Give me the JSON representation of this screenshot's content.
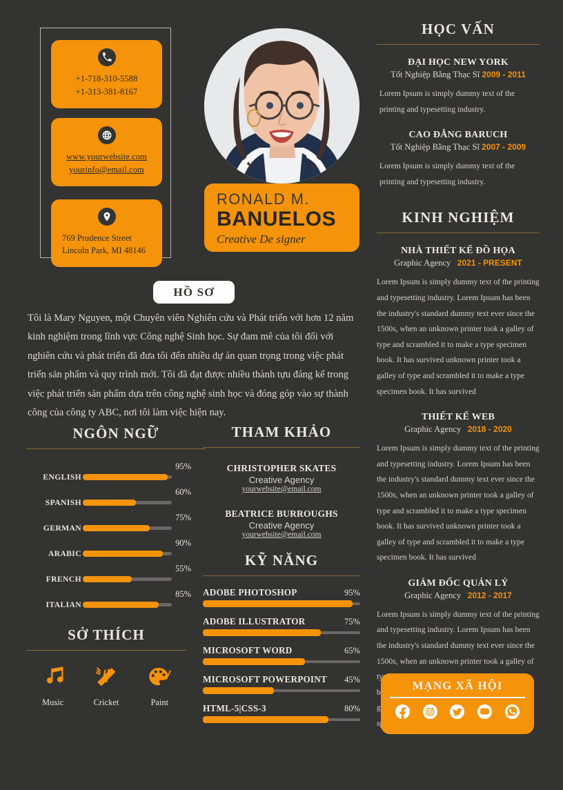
{
  "contact": {
    "phone": {
      "icon": "phone-icon",
      "lines": [
        "+1-718-310-5588",
        "+1-313-381-8167"
      ]
    },
    "web": {
      "icon": "globe-icon",
      "lines": [
        "www.yourwebsite.com",
        "yourinfo@email.com"
      ]
    },
    "address": {
      "icon": "location-pin-icon",
      "lines": [
        "769 Prudence Street",
        "Lincoln Park, MI 48146"
      ]
    }
  },
  "identity": {
    "first_name": "RONALD M.",
    "last_name": "BANUELOS",
    "role": "Creative De signer"
  },
  "profile": {
    "badge": "HỒ SƠ",
    "text": "Tôi là Mary Nguyen, một Chuyên viên Nghiên cứu và Phát triển với hơn 12 năm kinh nghiệm trong lĩnh vực Công nghệ Sinh học. Sự đam mê của tôi đối với nghiên cứu và phát triển đã đưa tôi đến nhiều dự án quan trọng trong việc phát triển sản phẩm và quy trình mới. Tôi đã đạt được nhiều thành tựu đáng kể trong việc phát triển sản phẩm dựa trên công nghệ sinh học và đóng góp vào sự thành công của công ty ABC, nơi tôi làm việc hiện nay."
  },
  "languages": {
    "title": "NGÔN NGỮ",
    "items": [
      {
        "name": "ENGLISH",
        "percent": "95%",
        "value": 95
      },
      {
        "name": "SPANISH",
        "percent": "60%",
        "value": 60
      },
      {
        "name": "GERMAN",
        "percent": "75%",
        "value": 75
      },
      {
        "name": "ARABIC",
        "percent": "90%",
        "value": 90
      },
      {
        "name": "FRENCH",
        "percent": "55%",
        "value": 55
      },
      {
        "name": "ITALIAN",
        "percent": "85%",
        "value": 85
      }
    ]
  },
  "hobbies": {
    "title": "SỞ THÍCH",
    "items": [
      {
        "label": "Music",
        "icon": "music-notes-icon"
      },
      {
        "label": "Cricket",
        "icon": "cricket-bat-icon"
      },
      {
        "label": "Paint",
        "icon": "paint-palette-icon"
      }
    ]
  },
  "references": {
    "title": "THAM KHẢO",
    "items": [
      {
        "name": "CHRISTOPHER SKATES",
        "org": "Creative Agency",
        "email": "yourwebsite@email.com"
      },
      {
        "name": "BEATRICE BURROUGHS",
        "org": "Creative Agency",
        "email": "yourwebsite@email.com"
      }
    ]
  },
  "skills": {
    "title": "KỸ NĂNG",
    "items": [
      {
        "name": "ADOBE PHOTOSHOP",
        "percent": "95%",
        "value": 95
      },
      {
        "name": "ADOBE ILLUSTRATOR",
        "percent": "75%",
        "value": 75
      },
      {
        "name": "MICROSOFT WORD",
        "percent": "65%",
        "value": 65
      },
      {
        "name": "MICROSOFT POWERPOINT",
        "percent": "45%",
        "value": 45
      },
      {
        "name": "HTML-5|CSS-3",
        "percent": "80%",
        "value": 80
      }
    ]
  },
  "education": {
    "title": "HỌC VẤN",
    "items": [
      {
        "school": "ĐẠI HỌC NEW YORK",
        "degree": "Tốt Nghiệp Bằng Thạc Sĩ",
        "years": "2009 - 2011",
        "body": "Lorem Ipsum is simply dummy text of the printing and typesetting industry."
      },
      {
        "school": "CAO ĐẲNG BARUCH",
        "degree": "Tốt Nghiệp Bằng Thạc Sĩ",
        "years": "2007 - 2009",
        "body": "Lorem Ipsum is simply dummy text of the printing and typesetting industry."
      }
    ]
  },
  "experience": {
    "title": "KINH NGHIỆM",
    "items": [
      {
        "role": "NHÀ THIẾT KẾ ĐỒ HỌA",
        "company": "Graphic Agency",
        "years": "2021 - PRESENT",
        "body": "Lorem Ipsum is simply dummy text of the printing and typesetting industry. Lorem Ipsum has been the industry's  standard dummy text ever since the 1500s, when an  unknown printer took a galley of type and scrambled it to  make a type specimen book. It has survived unknown printer took a galley of type and scrambled it to make a type specimen book. It has survived"
      },
      {
        "role": "THIẾT KẾ WEB",
        "company": "Graphic Agency",
        "years": "2018 - 2020",
        "body": "Lorem Ipsum is simply dummy text of the printing and typesetting industry. Lorem Ipsum has been the industry's  standard dummy text ever since the 1500s, when an  unknown printer took a galley of type and scrambled it to  make a type specimen book. It has survived unknown printer took a galley of type and scrambled it to make a type specimen book. It has survived"
      },
      {
        "role": "GIÁM ĐỐC QUẢN LÝ",
        "company": "Graphic Agency",
        "years": "2012 - 2017",
        "body": "Lorem Ipsum is simply dummy text of the printing and typesetting industry. Lorem Ipsum has been the industry's  standard dummy text ever since the 1500s, when an  unknown printer took a galley of type and scrambled it to  make a type specimen book. It has survived unknown printer took a galley of type and scrambled it to make a type specimen book. It has survived"
      }
    ]
  },
  "social": {
    "title": "MẠNG XÃ HỘI",
    "icons": [
      "facebook-icon",
      "instagram-icon",
      "twitter-icon",
      "youtube-icon",
      "whatsapp-icon"
    ]
  },
  "colors": {
    "background": "#333331",
    "accent": "#F5930A",
    "text": "#e8e6e1",
    "rule": "#8a6a33"
  }
}
